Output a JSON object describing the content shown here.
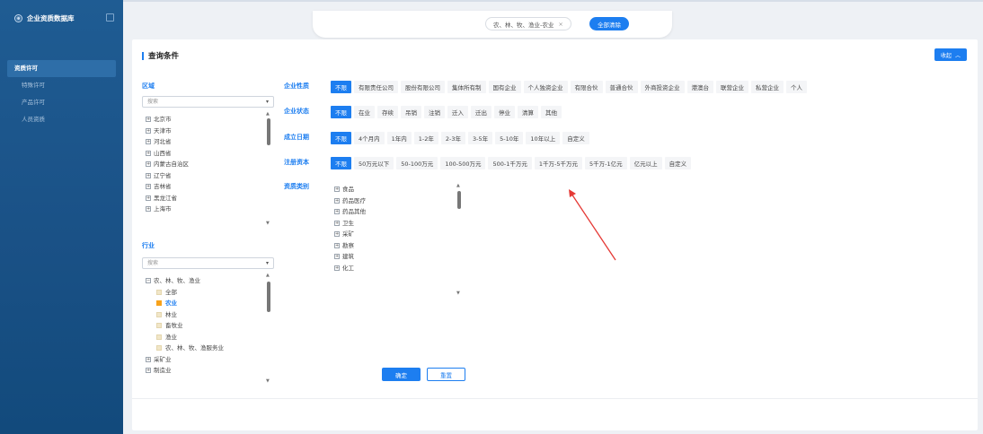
{
  "sidebar": {
    "title": "企业资质数据库",
    "items": [
      {
        "label": "资质许可",
        "active": true
      },
      {
        "label": "特殊许可",
        "active": false
      },
      {
        "label": "产品许可",
        "active": false
      },
      {
        "label": "人员资质",
        "active": false
      }
    ]
  },
  "topbar": {
    "active_filter": "农、林、牧、渔业-农业",
    "clear_all_label": "全部清除"
  },
  "panel": {
    "title": "查询条件",
    "collapse_label": "收起"
  },
  "region": {
    "label": "区域",
    "search_placeholder": "搜索",
    "items": [
      "北京市",
      "天津市",
      "河北省",
      "山西省",
      "内蒙古自治区",
      "辽宁省",
      "吉林省",
      "黑龙江省",
      "上海市"
    ]
  },
  "industry": {
    "label": "行业",
    "search_placeholder": "搜索",
    "group": "农、林、牧、渔业",
    "children": [
      {
        "label": "全部",
        "checked": false
      },
      {
        "label": "农业",
        "checked": true
      },
      {
        "label": "林业",
        "checked": false
      },
      {
        "label": "畜牧业",
        "checked": false
      },
      {
        "label": "渔业",
        "checked": false
      },
      {
        "label": "农、林、牧、渔服务业",
        "checked": false
      }
    ],
    "more": [
      "采矿业",
      "制造业"
    ]
  },
  "filters": {
    "nature": {
      "label": "企业性质",
      "options": [
        "不限",
        "有限责任公司",
        "股份有限公司",
        "集体所有制",
        "国有企业",
        "个人独资企业",
        "有限合伙",
        "普通合伙",
        "外商投资企业",
        "港澳台",
        "联营企业",
        "私营企业",
        "个人"
      ]
    },
    "status": {
      "label": "企业状态",
      "options": [
        "不限",
        "在业",
        "存续",
        "吊销",
        "注销",
        "迁入",
        "迁出",
        "停业",
        "清算",
        "其他"
      ]
    },
    "established": {
      "label": "成立日期",
      "options": [
        "不限",
        "4个月内",
        "1年内",
        "1-2年",
        "2-3年",
        "3-5年",
        "5-10年",
        "10年以上",
        "自定义"
      ]
    },
    "capital": {
      "label": "注册资本",
      "options": [
        "不限",
        "50万元以下",
        "50-100万元",
        "100-500万元",
        "500-1千万元",
        "1千万-5千万元",
        "5千万-1亿元",
        "亿元以上",
        "自定义"
      ]
    },
    "qualification": {
      "label": "资质类别",
      "items": [
        "食品",
        "药品医疗",
        "药品其他",
        "卫生",
        "采矿",
        "勘察",
        "建筑",
        "化工"
      ]
    }
  },
  "actions": {
    "confirm_label": "确定",
    "reset_label": "重置"
  },
  "colors": {
    "accent": "#1d7ef0",
    "sidebar": "#1a5186",
    "checked": "#f7a21b",
    "annotation_arrow": "#e53935"
  }
}
